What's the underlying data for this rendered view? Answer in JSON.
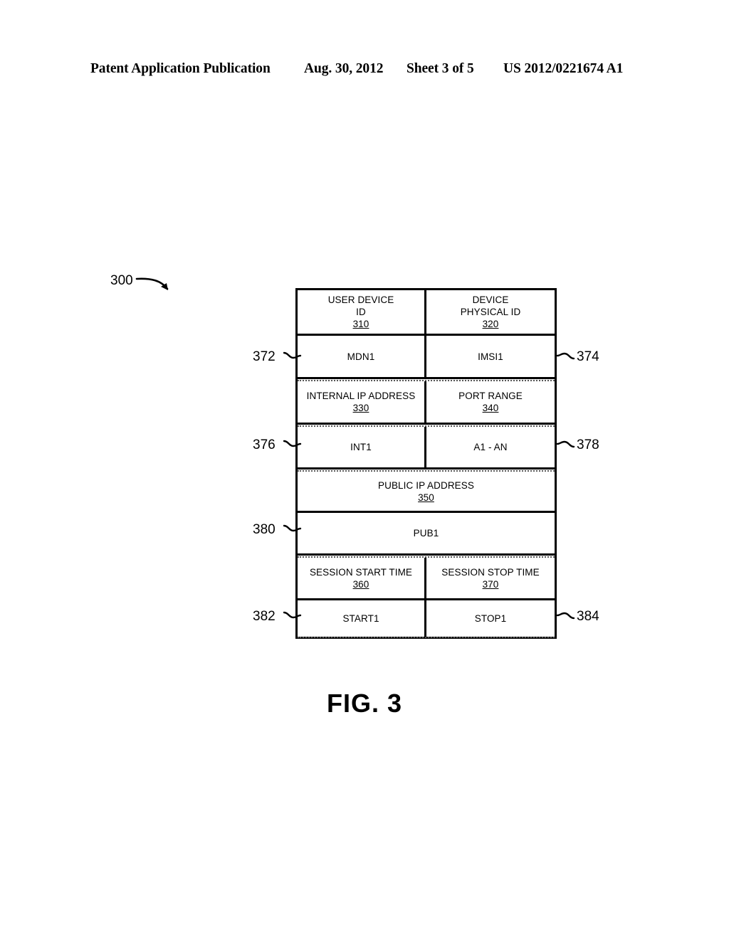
{
  "header": {
    "publication": "Patent Application Publication",
    "date": "Aug. 30, 2012",
    "sheet": "Sheet 3 of 5",
    "patent_number": "US 2012/0221674 A1"
  },
  "figure": {
    "caption": "FIG. 3",
    "diagram_ref": "300",
    "table": {
      "rows": [
        {
          "kind": "header",
          "cells": [
            {
              "label": "USER DEVICE\nID",
              "line1": "USER DEVICE",
              "line2": "ID",
              "ref": "310"
            },
            {
              "label": "DEVICE\nPHYSICAL ID",
              "line1": "DEVICE",
              "line2": "PHYSICAL ID",
              "ref": "320"
            }
          ]
        },
        {
          "kind": "value",
          "cells": [
            {
              "value": "MDN1",
              "ref": "372",
              "ref_side": "left"
            },
            {
              "value": "IMSI1",
              "ref": "374",
              "ref_side": "right"
            }
          ]
        },
        {
          "kind": "header",
          "cells": [
            {
              "line1": "INTERNAL IP ADDRESS",
              "line2": "",
              "ref": "330"
            },
            {
              "line1": "PORT RANGE",
              "line2": "",
              "ref": "340"
            }
          ]
        },
        {
          "kind": "value",
          "cells": [
            {
              "value": "INT1",
              "ref": "376",
              "ref_side": "left"
            },
            {
              "value": "A1 - AN",
              "ref": "378",
              "ref_side": "right"
            }
          ]
        },
        {
          "kind": "header-full",
          "cells": [
            {
              "line1": "PUBLIC IP ADDRESS",
              "line2": "",
              "ref": "350"
            }
          ]
        },
        {
          "kind": "value-full",
          "cells": [
            {
              "value": "PUB1",
              "ref": "380",
              "ref_side": "left"
            }
          ]
        },
        {
          "kind": "header",
          "cells": [
            {
              "line1": "SESSION START TIME",
              "line2": "",
              "ref": "360"
            },
            {
              "line1": "SESSION STOP TIME",
              "line2": "",
              "ref": "370"
            }
          ]
        },
        {
          "kind": "value",
          "cells": [
            {
              "value": "START1",
              "ref": "382",
              "ref_side": "left"
            },
            {
              "value": "STOP1",
              "ref": "384",
              "ref_side": "right"
            }
          ]
        }
      ],
      "left_refs": [
        "372",
        "376",
        "380",
        "382"
      ],
      "right_refs": [
        "374",
        "378",
        "384"
      ]
    }
  }
}
